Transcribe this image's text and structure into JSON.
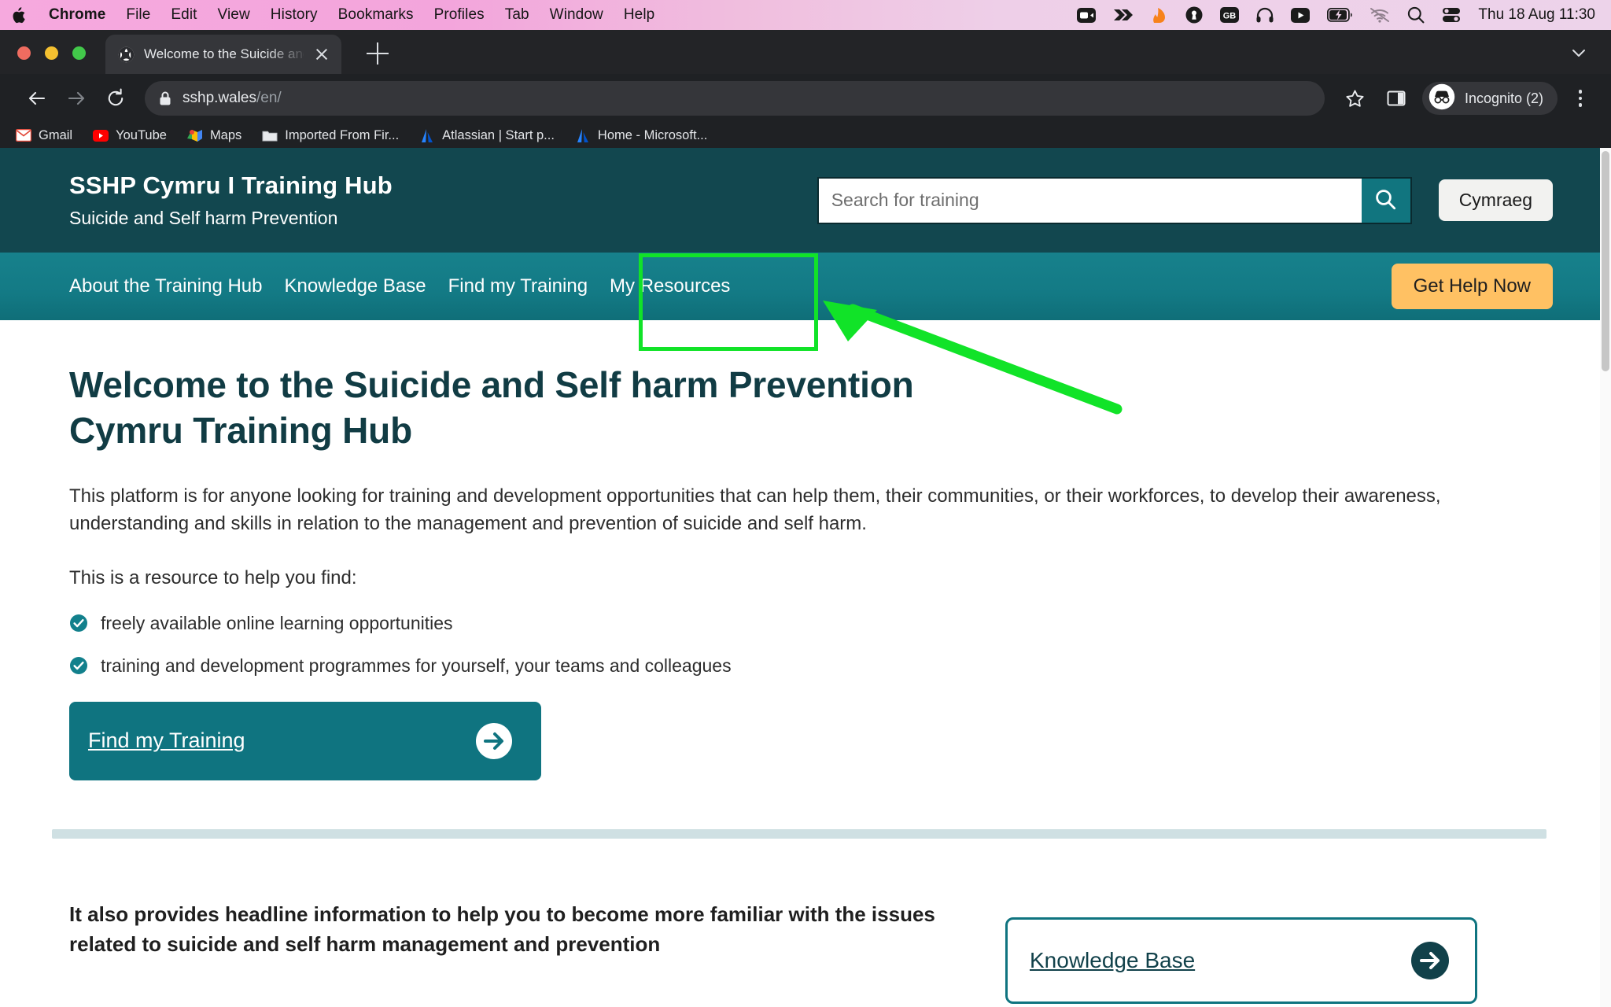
{
  "os_bar": {
    "apple_icon": "apple-logo-icon",
    "menus": [
      {
        "label": "Chrome",
        "bold": true
      },
      {
        "label": "File",
        "bold": false
      },
      {
        "label": "Edit",
        "bold": false
      },
      {
        "label": "View",
        "bold": false
      },
      {
        "label": "History",
        "bold": false
      },
      {
        "label": "Bookmarks",
        "bold": false
      },
      {
        "label": "Profiles",
        "bold": false
      },
      {
        "label": "Tab",
        "bold": false
      },
      {
        "label": "Window",
        "bold": false
      },
      {
        "label": "Help",
        "bold": false
      }
    ],
    "status_icons": [
      "video-camera-icon",
      "double-chevron-icon",
      "orange-flame-icon",
      "keyhole-icon",
      "gb-keyboard-icon",
      "headphones-icon",
      "play-button-icon",
      "battery-charging-icon",
      "wifi-off-icon",
      "spotlight-search-icon",
      "control-center-icon"
    ],
    "clock": "Thu 18 Aug  11:30"
  },
  "browser": {
    "tab": {
      "title": "Welcome to the Suicide and se",
      "favicon": "globe-icon",
      "close_icon": "close-icon"
    },
    "new_tab_label": "+",
    "toolbar": {
      "back_icon": "back-arrow-icon",
      "forward_icon": "forward-arrow-icon",
      "reload_icon": "reload-icon",
      "lock_icon": "lock-icon",
      "url_main": "sshp.wales",
      "url_path": "/en/",
      "bookmark_star_icon": "star-icon",
      "side_panel_icon": "side-panel-icon",
      "profile_label": "Incognito (2)",
      "profile_icon": "incognito-icon",
      "menu_icon": "kebab-menu-icon"
    },
    "bookmarks": [
      {
        "label": "Gmail",
        "icon": "gmail-icon"
      },
      {
        "label": "YouTube",
        "icon": "youtube-icon"
      },
      {
        "label": "Maps",
        "icon": "maps-icon"
      },
      {
        "label": "Imported From Fir...",
        "icon": "folder-icon"
      },
      {
        "label": "Atlassian | Start p...",
        "icon": "atlassian-icon"
      },
      {
        "label": "Home - Microsoft...",
        "icon": "atlassian-icon"
      }
    ]
  },
  "site": {
    "header": {
      "title": "SSHP Cymru I Training Hub",
      "subtitle": "Suicide and Self harm Prevention",
      "search_placeholder": "Search for training",
      "search_value": "",
      "search_icon": "search-icon",
      "language_button": "Cymraeg"
    },
    "nav": {
      "items": [
        {
          "label": "About the Training Hub"
        },
        {
          "label": "Knowledge Base"
        },
        {
          "label": "Find my Training"
        },
        {
          "label": "My Resources"
        }
      ],
      "help_button": "Get Help Now"
    },
    "main": {
      "heading": "Welcome to the Suicide and Self harm Prevention Cymru Training Hub",
      "intro": "This platform is for anyone looking for training and development opportunities that can help them, their communities, or their workforces, to develop their awareness, understanding and skills in relation to the management and prevention of suicide and self harm.",
      "list_intro": "This is a resource to help you find:",
      "list_items": [
        "freely available online learning opportunities",
        "training and development programmes for yourself, your teams and colleagues"
      ],
      "cta": {
        "label": "Find my Training",
        "arrow_icon": "arrow-right-circle-icon"
      },
      "lower_text": "It also provides headline information to help you to become more familiar with the issues related to suicide and self harm management and prevention",
      "knowledge_card": {
        "label": "Knowledge Base",
        "arrow_icon": "arrow-right-circle-icon"
      }
    }
  },
  "annotation": {
    "highlight_target": "My Resources",
    "color": "#11e328",
    "shape": "rectangle-with-arrow"
  },
  "colors": {
    "header_teal": "#12474f",
    "nav_teal": "#137a85",
    "cta_teal": "#0f7480",
    "help_amber": "#ffc163",
    "heading_teal": "#113c44",
    "divider_blue": "#cfe0e3",
    "annotation_green": "#11e328"
  }
}
